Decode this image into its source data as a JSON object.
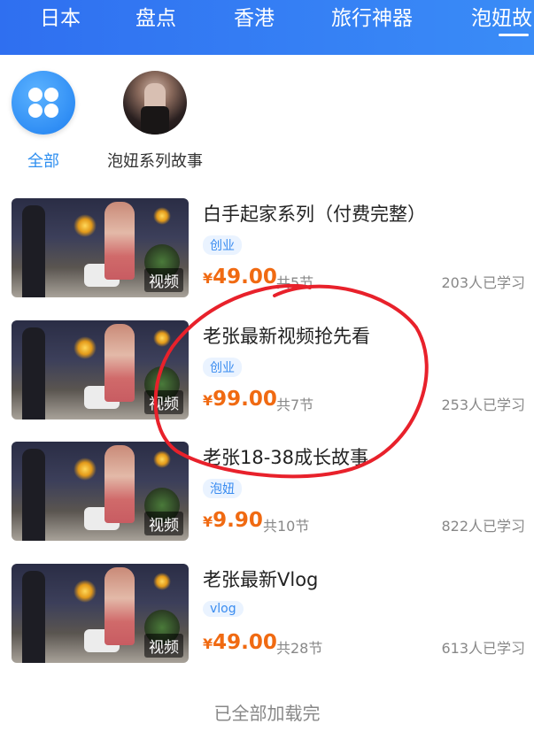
{
  "tabs": [
    "日本",
    "盘点",
    "香港",
    "旅行神器",
    "泡妞故"
  ],
  "categories": [
    {
      "label": "全部",
      "icon": "four-petal-icon"
    },
    {
      "label": "泡妞系列故事",
      "icon": "avatar-photo"
    }
  ],
  "courses": [
    {
      "title": "白手起家系列（付费完整）",
      "tag": "创业",
      "price_symbol": "¥",
      "price": "49.00",
      "lessons": "共5节",
      "learners": "203人已学习",
      "badge": "视频"
    },
    {
      "title": "老张最新视频抢先看",
      "tag": "创业",
      "price_symbol": "¥",
      "price": "99.00",
      "lessons": "共7节",
      "learners": "253人已学习",
      "badge": "视频"
    },
    {
      "title": "老张18-38成长故事",
      "tag": "泡妞",
      "price_symbol": "¥",
      "price": "9.90",
      "lessons": "共10节",
      "learners": "822人已学习",
      "badge": "视频"
    },
    {
      "title": "老张最新Vlog",
      "tag": "vlog",
      "price_symbol": "¥",
      "price": "49.00",
      "lessons": "共28节",
      "learners": "613人已学习",
      "badge": "视频"
    }
  ],
  "footer": {
    "loaded_text": "已全部加载完"
  },
  "colors": {
    "tabbar": "#3a8cf7",
    "accent": "#2f8ff0",
    "price": "#f06a12",
    "annotation": "#e8212b"
  }
}
